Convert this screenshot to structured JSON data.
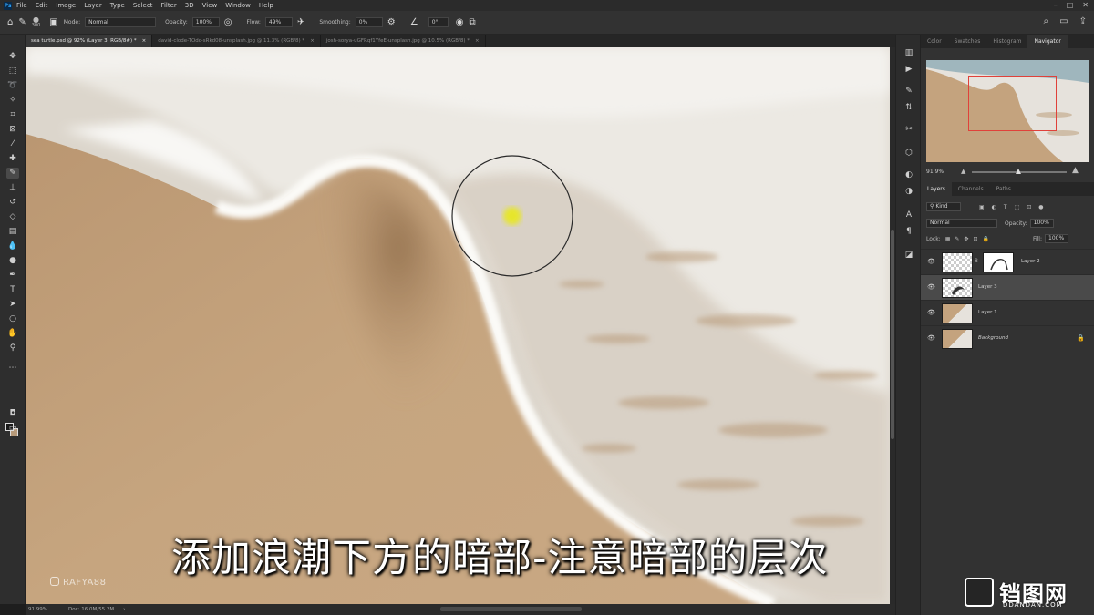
{
  "app": {
    "logo": "Ps",
    "menus": [
      "File",
      "Edit",
      "Image",
      "Layer",
      "Type",
      "Select",
      "Filter",
      "3D",
      "View",
      "Window",
      "Help"
    ]
  },
  "options": {
    "brush_size": "300",
    "mode_label": "Mode:",
    "mode_value": "Normal",
    "opacity_label": "Opacity:",
    "opacity_value": "100%",
    "flow_label": "Flow:",
    "flow_value": "49%",
    "smoothing_label": "Smoothing:",
    "smoothing_value": "0%",
    "angle_value": "0°"
  },
  "tabs": [
    {
      "label": "sea turtle.psd @ 92% (Layer 3, RGB/8#) *",
      "close": "×"
    },
    {
      "label": "david-clode-TOdc-sRkd08-unsplash.jpg @ 11.3% (RGB/8) *",
      "close": "×"
    },
    {
      "label": "josh-sorya-uGFRqf1YfeE-unsplash.jpg @ 10.5% (RGB/8) *",
      "close": "×"
    }
  ],
  "status": {
    "zoom": "91.99%",
    "doc": "Doc: 16.0M/55.2M"
  },
  "subtitle": "添加浪潮下方的暗部-注意暗部的层次",
  "watermark": "RAFYA88",
  "site": {
    "name": "铛图网",
    "domain": "DDANDAN.COM"
  },
  "panels": {
    "top_tabs": [
      "Color",
      "Swatches",
      "Histogram",
      "Navigator"
    ],
    "navigator_zoom": "91.9%",
    "layer_tabs": [
      "Layers",
      "Channels",
      "Paths"
    ],
    "filter_kind": "Kind",
    "blend_mode": "Normal",
    "opacity_label": "Opacity:",
    "opacity_value": "100%",
    "lock_label": "Lock:",
    "fill_label": "Fill:",
    "fill_value": "100%",
    "layers": [
      {
        "name": "Layer 2"
      },
      {
        "name": "Layer 3"
      },
      {
        "name": "Layer 1"
      },
      {
        "name": "Background"
      }
    ]
  },
  "colors": {
    "sand": "#c4a37e",
    "foam": "#f2f0ec",
    "brush_cursor": "#e8e81e",
    "nav_view_rect": "#e0413a"
  }
}
